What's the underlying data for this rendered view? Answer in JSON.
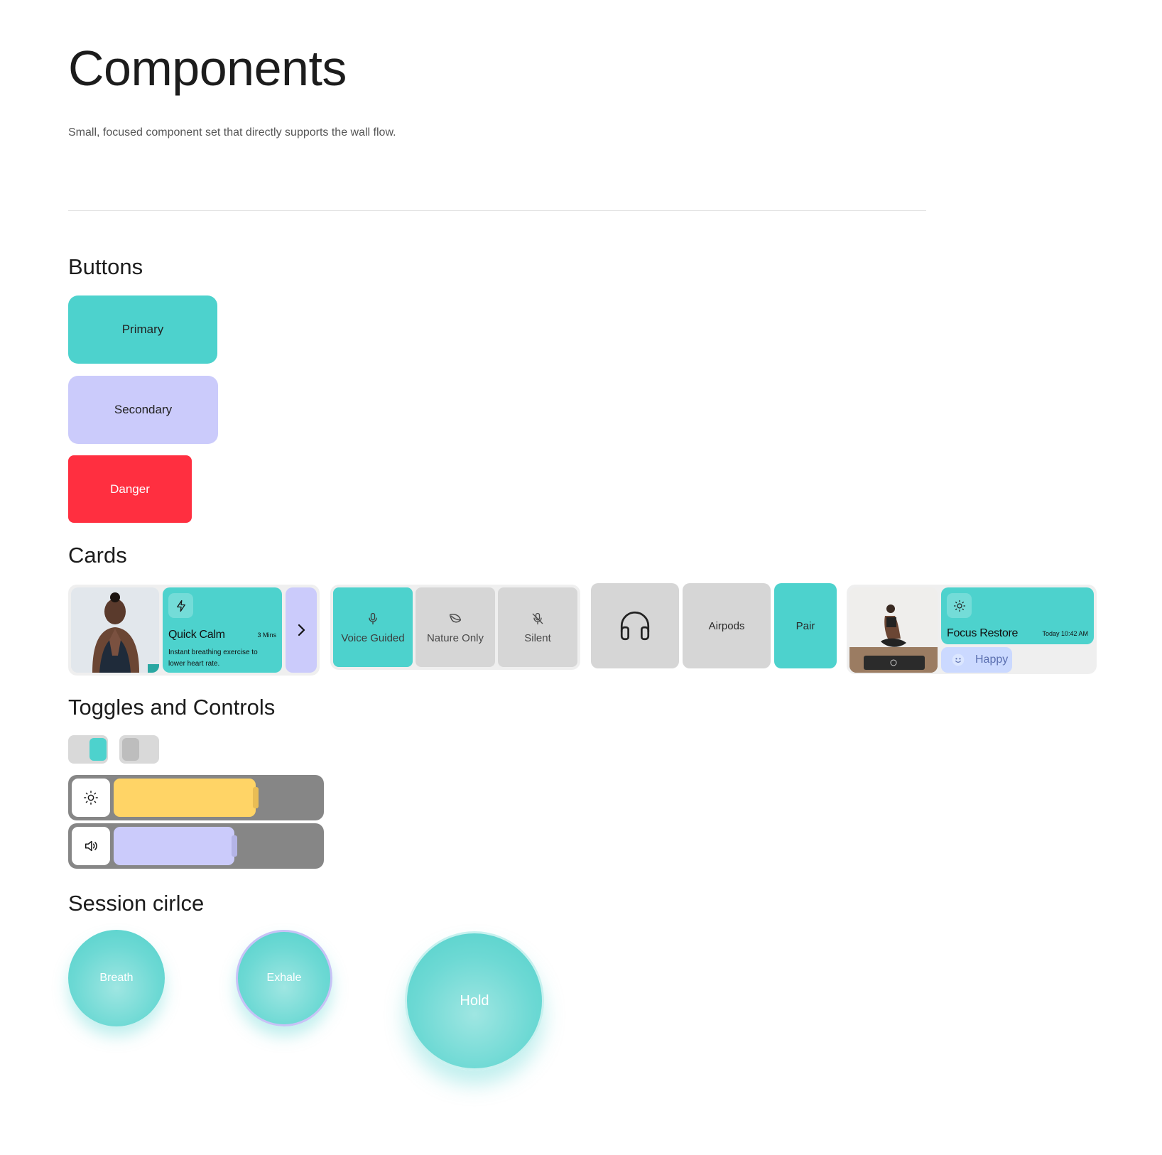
{
  "header": {
    "title": "Components",
    "subtitle": "Small, focused component set that directly supports the wall flow."
  },
  "sections": {
    "buttons": "Buttons",
    "cards": "Cards",
    "toggles": "Toggles and Controls",
    "session": "Session cirlce"
  },
  "buttons": {
    "primary": "Primary",
    "secondary": "Secondary",
    "danger": "Danger"
  },
  "cards": {
    "quick": {
      "title": "Quick Calm",
      "duration": "3 Mins",
      "description": "Instant breathing exercise to lower heart rate.",
      "icon": "lightning-icon",
      "arrow_icon": "chevron-right-icon"
    },
    "audio_modes": [
      {
        "label": "Voice Guided",
        "icon": "microphone-icon",
        "active": true
      },
      {
        "label": "Nature Only",
        "icon": "leaf-icon",
        "active": false
      },
      {
        "label": "Silent",
        "icon": "mic-off-icon",
        "active": false
      }
    ],
    "device": {
      "icon": "headphones-icon",
      "name": "Airpods",
      "action": "Pair"
    },
    "journal": {
      "title": "Focus Restore",
      "time": "Today 10:42 AM",
      "icon": "sun-icon",
      "mood": "Happy",
      "mood_icon": "smile-icon"
    }
  },
  "controls": {
    "toggle_on": true,
    "toggle_off": false,
    "brightness": {
      "icon": "sun-icon",
      "level": 0.62
    },
    "volume": {
      "icon": "speaker-icon",
      "level": 0.54
    }
  },
  "session": {
    "breath": "Breath",
    "exhale": "Exhale",
    "hold": "Hold"
  },
  "colors": {
    "teal": "#4dd2cd",
    "lavender": "#cbcbfb",
    "danger": "#ff2f40",
    "yellow": "#ffd466",
    "grey": "#d6d6d6"
  }
}
